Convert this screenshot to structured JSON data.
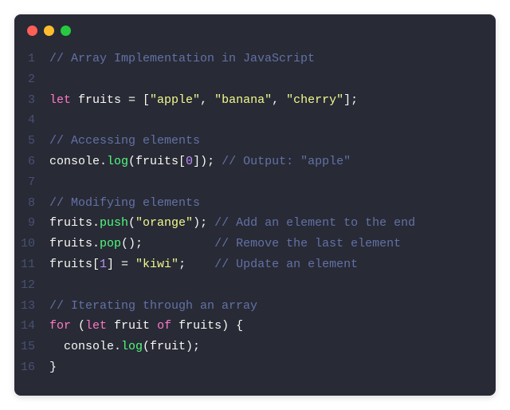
{
  "titlebar": {
    "buttons": [
      "close",
      "minimize",
      "maximize"
    ]
  },
  "code": {
    "lines": [
      {
        "n": 1,
        "tokens": [
          {
            "c": "comment",
            "t": "// Array Implementation in JavaScript"
          }
        ]
      },
      {
        "n": 2,
        "tokens": []
      },
      {
        "n": 3,
        "tokens": [
          {
            "c": "keyword",
            "t": "let"
          },
          {
            "c": "plain",
            "t": " fruits "
          },
          {
            "c": "punct",
            "t": "= ["
          },
          {
            "c": "string",
            "t": "\"apple\""
          },
          {
            "c": "punct",
            "t": ", "
          },
          {
            "c": "string",
            "t": "\"banana\""
          },
          {
            "c": "punct",
            "t": ", "
          },
          {
            "c": "string",
            "t": "\"cherry\""
          },
          {
            "c": "punct",
            "t": "];"
          }
        ]
      },
      {
        "n": 4,
        "tokens": []
      },
      {
        "n": 5,
        "tokens": [
          {
            "c": "comment",
            "t": "// Accessing elements"
          }
        ]
      },
      {
        "n": 6,
        "tokens": [
          {
            "c": "plain",
            "t": "console."
          },
          {
            "c": "method",
            "t": "log"
          },
          {
            "c": "punct",
            "t": "(fruits["
          },
          {
            "c": "number",
            "t": "0"
          },
          {
            "c": "punct",
            "t": "]); "
          },
          {
            "c": "comment",
            "t": "// Output: \"apple\""
          }
        ]
      },
      {
        "n": 7,
        "tokens": []
      },
      {
        "n": 8,
        "tokens": [
          {
            "c": "comment",
            "t": "// Modifying elements"
          }
        ]
      },
      {
        "n": 9,
        "tokens": [
          {
            "c": "plain",
            "t": "fruits."
          },
          {
            "c": "method",
            "t": "push"
          },
          {
            "c": "punct",
            "t": "("
          },
          {
            "c": "string",
            "t": "\"orange\""
          },
          {
            "c": "punct",
            "t": "); "
          },
          {
            "c": "comment",
            "t": "// Add an element to the end"
          }
        ]
      },
      {
        "n": 10,
        "tokens": [
          {
            "c": "plain",
            "t": "fruits."
          },
          {
            "c": "method",
            "t": "pop"
          },
          {
            "c": "punct",
            "t": "();          "
          },
          {
            "c": "comment",
            "t": "// Remove the last element"
          }
        ]
      },
      {
        "n": 11,
        "tokens": [
          {
            "c": "plain",
            "t": "fruits["
          },
          {
            "c": "number",
            "t": "1"
          },
          {
            "c": "punct",
            "t": "] = "
          },
          {
            "c": "string",
            "t": "\"kiwi\""
          },
          {
            "c": "punct",
            "t": ";    "
          },
          {
            "c": "comment",
            "t": "// Update an element"
          }
        ]
      },
      {
        "n": 12,
        "tokens": []
      },
      {
        "n": 13,
        "tokens": [
          {
            "c": "comment",
            "t": "// Iterating through an array"
          }
        ]
      },
      {
        "n": 14,
        "tokens": [
          {
            "c": "keyword",
            "t": "for"
          },
          {
            "c": "punct",
            "t": " ("
          },
          {
            "c": "keyword",
            "t": "let"
          },
          {
            "c": "plain",
            "t": " fruit "
          },
          {
            "c": "keyword",
            "t": "of"
          },
          {
            "c": "plain",
            "t": " fruits"
          },
          {
            "c": "punct",
            "t": ") {"
          }
        ]
      },
      {
        "n": 15,
        "tokens": [
          {
            "c": "plain",
            "t": "  console."
          },
          {
            "c": "method",
            "t": "log"
          },
          {
            "c": "punct",
            "t": "(fruit);"
          }
        ]
      },
      {
        "n": 16,
        "tokens": [
          {
            "c": "punct",
            "t": "}"
          }
        ]
      }
    ]
  }
}
